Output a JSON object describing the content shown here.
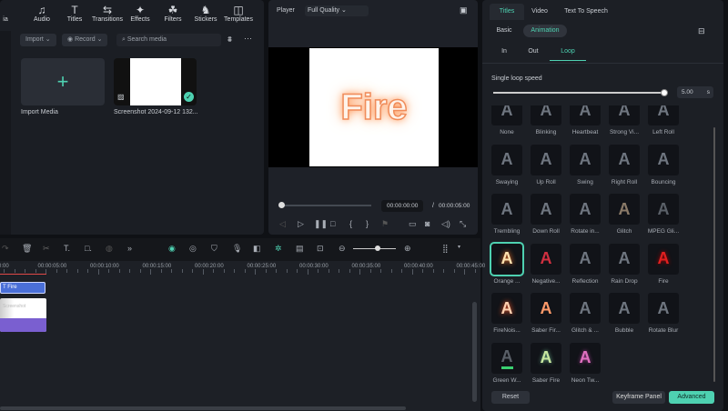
{
  "toolbar": {
    "items": [
      {
        "label": "ia",
        "icon": "media-icon"
      },
      {
        "label": "Audio",
        "icon": "music-note-icon"
      },
      {
        "label": "Titles",
        "icon": "text-t-icon"
      },
      {
        "label": "Transitions",
        "icon": "transitions-icon"
      },
      {
        "label": "Effects",
        "icon": "sparkle-icon"
      },
      {
        "label": "Filters",
        "icon": "filters-icon"
      },
      {
        "label": "Stickers",
        "icon": "sticker-icon"
      },
      {
        "label": "Templates",
        "icon": "templates-icon"
      }
    ]
  },
  "media": {
    "import_label": "Import",
    "record_label": "Record",
    "search_placeholder": "Search media",
    "import_media_label": "Import Media",
    "clip_name": "Screenshot 2024-09-12 132..."
  },
  "player": {
    "label": "Player",
    "quality": "Full Quality",
    "preview_text": "Fire",
    "current_time": "00:00:00:00",
    "separator": "/",
    "total_time": "00:00:05:00"
  },
  "right": {
    "tabs": [
      "Titles",
      "Video",
      "Text To Speech"
    ],
    "active_tab": "Titles",
    "subtabs": [
      "Basic",
      "Animation"
    ],
    "active_subtab": "Animation",
    "anim_tabs": [
      "In",
      "Out",
      "Loop"
    ],
    "active_anim_tab": "Loop",
    "speed_label": "Single loop speed",
    "speed_value": "5.00",
    "speed_unit": "s",
    "speed_fraction": 1.0,
    "animations": [
      "None",
      "Blinking",
      "Heartbeat",
      "Strong Vi...",
      "Left Roll",
      "Swaying",
      "Up Roll",
      "Swing",
      "Right Roll",
      "Bouncing",
      "Trembling",
      "Down Roll",
      "Rotate in...",
      "Glitch",
      "MPEG Gli...",
      "Orange ...",
      "Negative...",
      "Reflection",
      "Rain Drop",
      "Fire",
      "FireNois...",
      "Saber Fir...",
      "Glitch & ...",
      "Bubble",
      "Rotate Blur",
      "Green W...",
      "Saber Fire",
      "Neon Tw..."
    ],
    "selected": "Orange ...",
    "reset_label": "Reset",
    "keyframe_label": "Keyframe Panel",
    "advanced_label": "Advanced"
  },
  "timeline": {
    "ruler": [
      "0:00",
      "00:00:05:00",
      "00:00:10:00",
      "00:00:15:00",
      "00:00:20:00",
      "00:00:25:00",
      "00:00:30:00",
      "00:00:35:00",
      "00:00:40:00",
      "00:00:45:00"
    ],
    "title_clip": "Fire",
    "video_clip": "Screenshot"
  },
  "colors": {
    "accent": "#4ed1b1",
    "title_clip": "#4a6fd8",
    "video_clip": "#7a5fd0",
    "playhead": "#e04848"
  }
}
